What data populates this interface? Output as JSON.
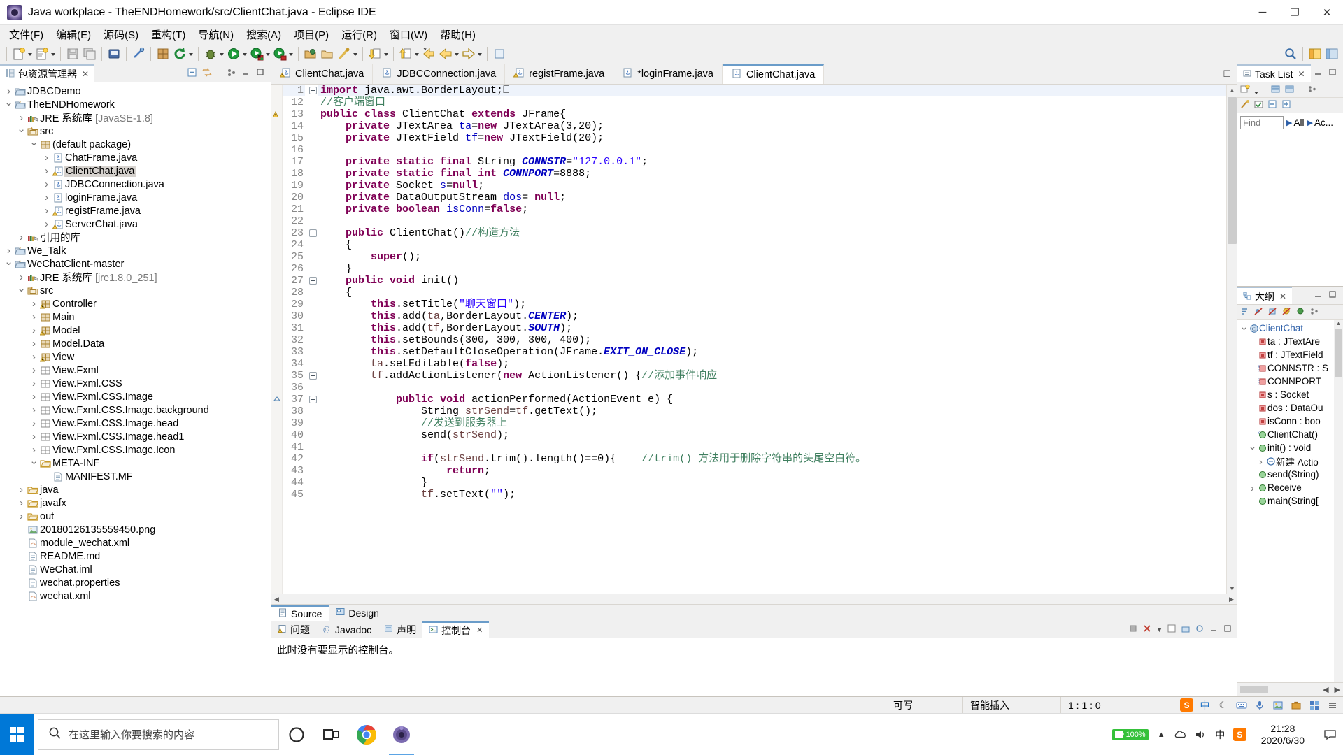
{
  "window": {
    "title": "Java workplace - TheENDHomework/src/ClientChat.java - Eclipse IDE",
    "icon": "eclipse-icon",
    "minimize": "─",
    "maximize": "❐",
    "close": "✕"
  },
  "menubar": [
    {
      "label": "文件(F)"
    },
    {
      "label": "编辑(E)"
    },
    {
      "label": "源码(S)"
    },
    {
      "label": "重构(T)"
    },
    {
      "label": "导航(N)"
    },
    {
      "label": "搜索(A)"
    },
    {
      "label": "项目(P)"
    },
    {
      "label": "运行(R)"
    },
    {
      "label": "窗口(W)"
    },
    {
      "label": "帮助(H)"
    }
  ],
  "package_explorer": {
    "tab_label": "包资源管理器",
    "tab_close": "✕",
    "tree": [
      {
        "depth": 0,
        "state": "closed",
        "icon": "project-icon",
        "label": "JDBCDemo"
      },
      {
        "depth": 0,
        "state": "open",
        "icon": "project-java-icon",
        "label": "TheENDHomework"
      },
      {
        "depth": 1,
        "state": "closed",
        "icon": "library-icon",
        "label": "JRE 系统库",
        "dim": "[JavaSE-1.8]"
      },
      {
        "depth": 1,
        "state": "open",
        "icon": "source-folder-icon",
        "label": "src"
      },
      {
        "depth": 2,
        "state": "open",
        "icon": "package-icon",
        "label": "(default package)"
      },
      {
        "depth": 3,
        "state": "closed",
        "icon": "java-file-icon",
        "label": "ChatFrame.java"
      },
      {
        "depth": 3,
        "state": "closed",
        "icon": "java-file-warning-icon",
        "label": "ClientChat.java",
        "selected": true
      },
      {
        "depth": 3,
        "state": "closed",
        "icon": "java-file-icon",
        "label": "JDBCConnection.java"
      },
      {
        "depth": 3,
        "state": "closed",
        "icon": "java-file-icon",
        "label": "loginFrame.java"
      },
      {
        "depth": 3,
        "state": "closed",
        "icon": "java-file-warning-icon",
        "label": "registFrame.java"
      },
      {
        "depth": 3,
        "state": "closed",
        "icon": "java-file-warning-icon",
        "label": "ServerChat.java"
      },
      {
        "depth": 1,
        "state": "closed",
        "icon": "library-icon",
        "label": "引用的库"
      },
      {
        "depth": 0,
        "state": "closed",
        "icon": "project-java-icon",
        "label": "We_Talk"
      },
      {
        "depth": 0,
        "state": "open",
        "icon": "project-java-icon",
        "label": "WeChatClient-master"
      },
      {
        "depth": 1,
        "state": "closed",
        "icon": "library-icon",
        "label": "JRE 系统库",
        "dim": "[jre1.8.0_251]"
      },
      {
        "depth": 1,
        "state": "open",
        "icon": "source-folder-icon",
        "label": "src"
      },
      {
        "depth": 2,
        "state": "closed",
        "icon": "package-warning-icon",
        "label": "Controller"
      },
      {
        "depth": 2,
        "state": "closed",
        "icon": "package-icon",
        "label": "Main"
      },
      {
        "depth": 2,
        "state": "closed",
        "icon": "package-warning-icon",
        "label": "Model"
      },
      {
        "depth": 2,
        "state": "closed",
        "icon": "package-icon",
        "label": "Model.Data"
      },
      {
        "depth": 2,
        "state": "closed",
        "icon": "package-warning-icon",
        "label": "View"
      },
      {
        "depth": 2,
        "state": "closed",
        "icon": "package-empty-icon",
        "label": "View.Fxml"
      },
      {
        "depth": 2,
        "state": "closed",
        "icon": "package-empty-icon",
        "label": "View.Fxml.CSS"
      },
      {
        "depth": 2,
        "state": "closed",
        "icon": "package-empty-icon",
        "label": "View.Fxml.CSS.Image"
      },
      {
        "depth": 2,
        "state": "closed",
        "icon": "package-empty-icon",
        "label": "View.Fxml.CSS.Image.background"
      },
      {
        "depth": 2,
        "state": "closed",
        "icon": "package-empty-icon",
        "label": "View.Fxml.CSS.Image.head"
      },
      {
        "depth": 2,
        "state": "closed",
        "icon": "package-empty-icon",
        "label": "View.Fxml.CSS.Image.head1"
      },
      {
        "depth": 2,
        "state": "closed",
        "icon": "package-empty-icon",
        "label": "View.Fxml.CSS.Image.Icon"
      },
      {
        "depth": 2,
        "state": "open",
        "icon": "folder-icon",
        "label": "META-INF"
      },
      {
        "depth": 3,
        "state": "none",
        "icon": "file-icon",
        "label": "MANIFEST.MF"
      },
      {
        "depth": 1,
        "state": "closed",
        "icon": "folder-icon",
        "label": "java"
      },
      {
        "depth": 1,
        "state": "closed",
        "icon": "folder-icon",
        "label": "javafx"
      },
      {
        "depth": 1,
        "state": "closed",
        "icon": "folder-icon",
        "label": "out"
      },
      {
        "depth": 1,
        "state": "none",
        "icon": "image-file-icon",
        "label": "20180126135559450.png"
      },
      {
        "depth": 1,
        "state": "none",
        "icon": "xml-file-icon",
        "label": "module_wechat.xml"
      },
      {
        "depth": 1,
        "state": "none",
        "icon": "file-icon",
        "label": "README.md"
      },
      {
        "depth": 1,
        "state": "none",
        "icon": "file-icon",
        "label": "WeChat.iml"
      },
      {
        "depth": 1,
        "state": "none",
        "icon": "file-icon",
        "label": "wechat.properties"
      },
      {
        "depth": 1,
        "state": "none",
        "icon": "xml-file-icon",
        "label": "wechat.xml"
      }
    ]
  },
  "editor": {
    "tabs": [
      {
        "label": "ClientChat.java",
        "icon": "java-file-warning-icon",
        "active": false,
        "dirty": false
      },
      {
        "label": "JDBCConnection.java",
        "icon": "java-file-icon",
        "active": false,
        "dirty": false
      },
      {
        "label": "registFrame.java",
        "icon": "java-file-warning-icon",
        "active": false,
        "dirty": false
      },
      {
        "label": "*loginFrame.java",
        "icon": "java-file-icon",
        "active": false,
        "dirty": true
      },
      {
        "label": "ClientChat.java",
        "icon": "java-file-active-icon",
        "active": true,
        "dirty": false
      }
    ],
    "minimize": "─",
    "maximize": "❐",
    "lines": [
      {
        "num": "1",
        "fold": "plus",
        "html": "<span class=\"k\">import</span> java.awt.BorderLayout;<span class=\"n\">⎕</span>",
        "highlight": true
      },
      {
        "num": "12",
        "fold": "",
        "html": "<span class=\"cm\">//客户端窗口</span>"
      },
      {
        "num": "13",
        "fold": "",
        "ann": "warning",
        "html": "<span class=\"k\">public class</span> ClientChat <span class=\"k\">extends</span> JFrame{"
      },
      {
        "num": "14",
        "fold": "",
        "html": "    <span class=\"k\">private</span> JTextArea <span class=\"fld\">ta</span>=<span class=\"k\">new</span> JTextArea(3,20);"
      },
      {
        "num": "15",
        "fold": "",
        "html": "    <span class=\"k\">private</span> JTextField <span class=\"fld\">tf</span>=<span class=\"k\">new</span> JTextField(20);"
      },
      {
        "num": "16",
        "fold": "",
        "html": ""
      },
      {
        "num": "17",
        "fold": "",
        "html": "    <span class=\"k\">private static final</span> String <span class=\"sf\">CONNSTR</span>=<span class=\"s\">\"127.0.0.1\"</span>;"
      },
      {
        "num": "18",
        "fold": "",
        "html": "    <span class=\"k\">private static final</span> <span class=\"k\">int</span> <span class=\"sf\">CONNPORT</span>=8888;"
      },
      {
        "num": "19",
        "fold": "",
        "html": "    <span class=\"k\">private</span> Socket <span class=\"fld\">s</span>=<span class=\"k\">null</span>;"
      },
      {
        "num": "20",
        "fold": "",
        "html": "    <span class=\"k\">private</span> DataOutputStream <span class=\"fld\">dos</span>= <span class=\"k\">null</span>;"
      },
      {
        "num": "21",
        "fold": "",
        "html": "    <span class=\"k\">private</span> <span class=\"k\">boolean</span> <span class=\"fld\">isConn</span>=<span class=\"k\">false</span>;"
      },
      {
        "num": "22",
        "fold": "",
        "html": ""
      },
      {
        "num": "23",
        "fold": "minus",
        "html": "    <span class=\"k\">public</span> ClientChat()<span class=\"cm\">//构造方法</span>"
      },
      {
        "num": "24",
        "fold": "",
        "html": "    {"
      },
      {
        "num": "25",
        "fold": "",
        "html": "        <span class=\"k\">super</span>();"
      },
      {
        "num": "26",
        "fold": "",
        "html": "    }"
      },
      {
        "num": "27",
        "fold": "minus",
        "html": "    <span class=\"k\">public</span> <span class=\"k\">void</span> init()"
      },
      {
        "num": "28",
        "fold": "",
        "html": "    {"
      },
      {
        "num": "29",
        "fold": "",
        "html": "        <span class=\"k\">this</span>.setTitle(<span class=\"s\">\"聊天窗口\"</span>);"
      },
      {
        "num": "30",
        "fold": "",
        "html": "        <span class=\"k\">this</span>.add(<span class=\"lv\">ta</span>,BorderLayout.<span class=\"sf\">CENTER</span>);"
      },
      {
        "num": "31",
        "fold": "",
        "html": "        <span class=\"k\">this</span>.add(<span class=\"lv\">tf</span>,BorderLayout.<span class=\"sf\">SOUTH</span>);"
      },
      {
        "num": "32",
        "fold": "",
        "html": "        <span class=\"k\">this</span>.setBounds(300, 300, 300, 400);"
      },
      {
        "num": "33",
        "fold": "",
        "html": "        <span class=\"k\">this</span>.setDefaultCloseOperation(JFrame.<span class=\"sf\">EXIT_ON_CLOSE</span>);"
      },
      {
        "num": "34",
        "fold": "",
        "html": "        <span class=\"lv\">ta</span>.setEditable(<span class=\"k\">false</span>);"
      },
      {
        "num": "35",
        "fold": "minus",
        "html": "        <span class=\"lv\">tf</span>.addActionListener(<span class=\"k\">new</span> ActionListener() {<span class=\"cm\">//添加事件响应</span>"
      },
      {
        "num": "36",
        "fold": "",
        "html": ""
      },
      {
        "num": "37",
        "fold": "minus",
        "ann": "override",
        "html": "            <span class=\"k\">public</span> <span class=\"k\">void</span> actionPerformed(ActionEvent e) {"
      },
      {
        "num": "38",
        "fold": "",
        "html": "                String <span class=\"lv\">strSend</span>=<span class=\"lv\">tf</span>.getText();"
      },
      {
        "num": "39",
        "fold": "",
        "html": "                <span class=\"cm\">//发送到服务器上</span>"
      },
      {
        "num": "40",
        "fold": "",
        "html": "                send(<span class=\"lv\">strSend</span>);"
      },
      {
        "num": "41",
        "fold": "",
        "html": ""
      },
      {
        "num": "42",
        "fold": "",
        "html": "                <span class=\"k\">if</span>(<span class=\"lv\">strSend</span>.trim().length()==0){    <span class=\"cm\">//trim() 方法用于删除字符串的头尾空白符。</span>"
      },
      {
        "num": "43",
        "fold": "",
        "html": "                    <span class=\"k\">return</span>;"
      },
      {
        "num": "44",
        "fold": "",
        "html": "                }"
      },
      {
        "num": "45",
        "fold": "",
        "html": "                <span class=\"lv\">tf</span>.setText(<span class=\"s\">\"\"</span>);"
      }
    ],
    "bottom_tabs": [
      {
        "label": "Source",
        "icon": "source-icon",
        "active": true
      },
      {
        "label": "Design",
        "icon": "design-icon",
        "active": false
      }
    ]
  },
  "console": {
    "tabs": [
      {
        "label": "问题",
        "icon": "problems-icon",
        "active": false,
        "closable": false
      },
      {
        "label": "Javadoc",
        "icon": "javadoc-icon",
        "active": false,
        "closable": false
      },
      {
        "label": "声明",
        "icon": "declaration-icon",
        "active": false,
        "closable": false
      },
      {
        "label": "控制台",
        "icon": "console-icon",
        "active": true,
        "closable": true
      }
    ],
    "close_glyph": "✕",
    "body_text": "此时没有要显示的控制台。"
  },
  "task_list": {
    "tab_label": "Task List",
    "tab_close": "✕",
    "find_placeholder": "Find",
    "find_value": "",
    "all_label": "All",
    "ac_label": "Ac...",
    "minimize": "─",
    "maximize": "❐"
  },
  "outline": {
    "tab_label": "大纲",
    "tab_close": "✕",
    "minimize": "─",
    "maximize": "❐",
    "items": [
      {
        "depth": 0,
        "state": "open",
        "icon": "class-icon",
        "label": "ClientChat",
        "color": "#2d5fa8"
      },
      {
        "depth": 1,
        "state": "none",
        "icon": "field-private-icon",
        "label": "ta : JTextAre",
        "color": "#000"
      },
      {
        "depth": 1,
        "state": "none",
        "icon": "field-private-icon",
        "label": "tf : JTextField",
        "color": "#000"
      },
      {
        "depth": 1,
        "state": "none",
        "icon": "field-static-final-icon",
        "label": "CONNSTR : S",
        "color": "#000"
      },
      {
        "depth": 1,
        "state": "none",
        "icon": "field-static-final-icon",
        "label": "CONNPORT",
        "color": "#000"
      },
      {
        "depth": 1,
        "state": "none",
        "icon": "field-private-icon",
        "label": "s : Socket",
        "color": "#000"
      },
      {
        "depth": 1,
        "state": "none",
        "icon": "field-private-icon",
        "label": "dos : DataOu",
        "color": "#000"
      },
      {
        "depth": 1,
        "state": "none",
        "icon": "field-private-icon",
        "label": "isConn : boo",
        "color": "#000"
      },
      {
        "depth": 1,
        "state": "none",
        "icon": "constructor-icon",
        "label": "ClientChat()",
        "color": "#000"
      },
      {
        "depth": 1,
        "state": "open",
        "icon": "method-icon",
        "label": "init() : void",
        "color": "#000"
      },
      {
        "depth": 2,
        "state": "closed",
        "icon": "anon-class-icon",
        "label": "新建 Actio",
        "color": "#000"
      },
      {
        "depth": 1,
        "state": "none",
        "icon": "method-icon",
        "label": "send(String)",
        "color": "#000"
      },
      {
        "depth": 1,
        "state": "closed",
        "icon": "method-icon",
        "label": "Receive",
        "color": "#000"
      },
      {
        "depth": 1,
        "state": "none",
        "icon": "method-icon",
        "label": "main(String[",
        "color": "#000"
      }
    ]
  },
  "statusbar": {
    "writable": "可写",
    "insert_mode": "智能插入",
    "position": "1 : 1 : 0"
  },
  "tray": {
    "sogou_badge": "S",
    "lang_cn": "中",
    "ime_icons": [
      "half-moon-icon",
      "keyboard-icon",
      "mic-icon",
      "image-icon",
      "toolbox-icon",
      "grid-icon",
      "menu-icon"
    ]
  },
  "taskbar": {
    "search_placeholder": "在这里输入你要搜索的内容",
    "search_icon": "search-icon",
    "cortana_icon": "cortana-circle-icon",
    "taskview_icon": "task-view-icon",
    "chrome_icon": "chrome-icon",
    "eclipse_icon": "eclipse-taskbar-icon",
    "battery_pct": "100%",
    "lang": "中",
    "sogou": "S",
    "time": "21:28",
    "date": "2020/6/30",
    "show_desktop": "notification-icon"
  }
}
